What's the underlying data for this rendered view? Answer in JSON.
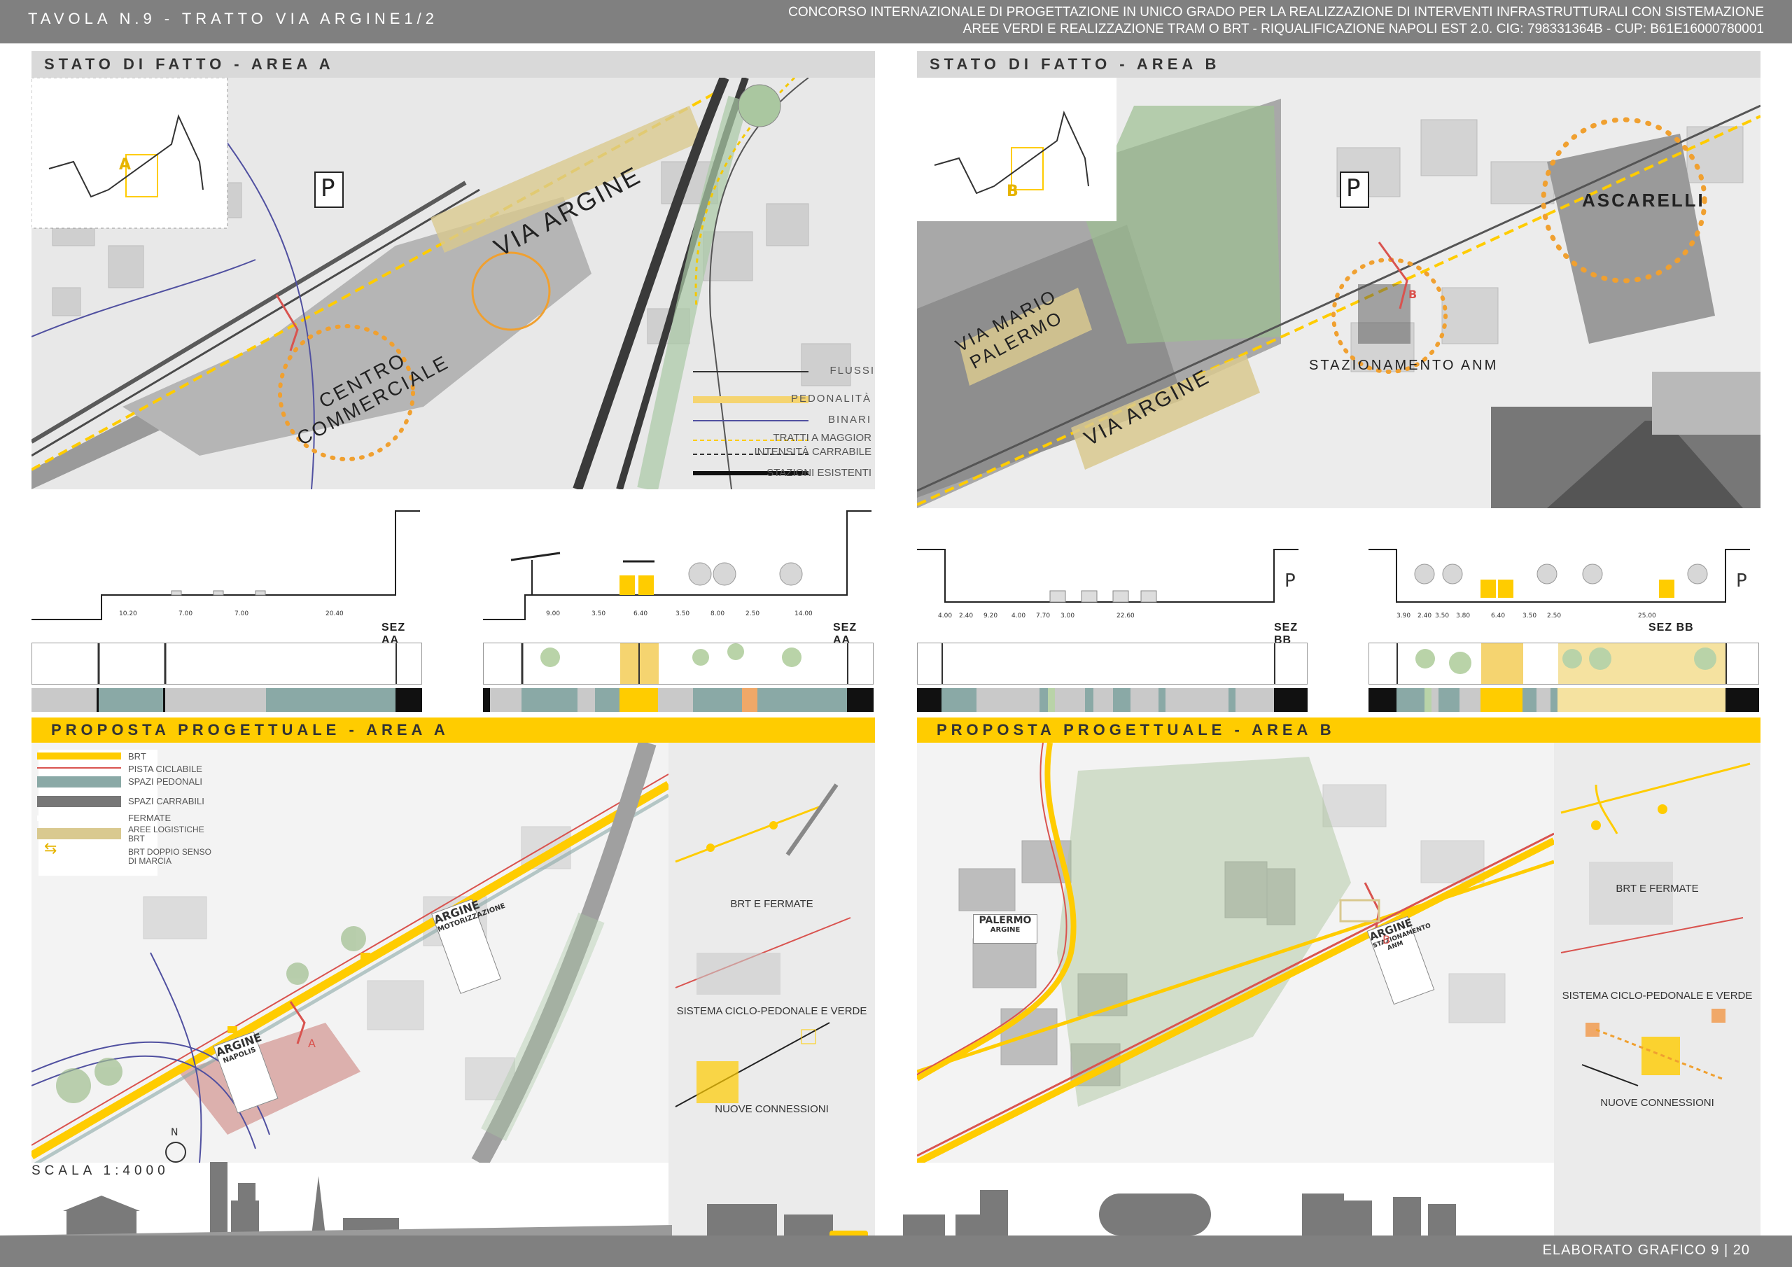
{
  "header": {
    "title_left": "TAVOLA N.9 - TRATTO VIA ARGINE1/2",
    "title_right_line1": "CONCORSO INTERNAZIONALE DI PROGETTAZIONE IN UNICO GRADO PER LA REALIZZAZIONE DI INTERVENTI INFRASTRUTTURALI CON SISTEMAZIONE",
    "title_right_line2": "AREE VERDI E REALIZZAZIONE TRAM O BRT - RIQUALIFICAZIONE NAPOLI EST 2.0. CIG: 798331364B - CUP: B61E16000780001"
  },
  "area_a_state": {
    "title": "STATO DI FATTO - AREA A",
    "key_map_letter": "A",
    "parking": "P",
    "street_label": "VIA ARGINE",
    "poi_label_1": "CENTRO",
    "poi_label_2": "COMMERCIALE",
    "legend": [
      {
        "label": "FLUSSI"
      },
      {
        "label": "PEDONALITÀ"
      },
      {
        "label": "BINARI"
      },
      {
        "label": "TRATTI A MAGGIOR"
      },
      {
        "label": "INTENSITÀ CARRABILE"
      },
      {
        "label": "STAZIONI ESISTENTI"
      }
    ]
  },
  "area_b_state": {
    "title": "STATO DI FATTO - AREA B",
    "key_map_letter": "B",
    "parking": "P",
    "street_label_1": "VIA MARIO",
    "street_label_2": "PALERMO",
    "street_label_main": "VIA ARGINE",
    "poi_1": "ASCARELLI",
    "poi_2": "STAZIONAMENTO ANM",
    "cut_marker": "B"
  },
  "sections": {
    "a_existing": {
      "label": "SEZ AA",
      "dims": [
        "10.20",
        "7.00",
        "7.00",
        "20.40"
      ]
    },
    "a_project": {
      "label": "SEZ AA",
      "dims": [
        "9.00",
        "3.50",
        "6.40",
        "3.50",
        "8.00",
        "2.50",
        "14.00"
      ]
    },
    "b_existing": {
      "label": "SEZ BB",
      "dims": [
        "4.00",
        "2.40",
        "9.20",
        "4.00",
        "7.70",
        "3.00",
        "22.60"
      ],
      "parking": "P"
    },
    "b_project": {
      "label": "SEZ BB",
      "dims": [
        "3.90",
        "2.40",
        "3.50",
        "3.80",
        "6.40",
        "3.50",
        "2.50",
        "25.00"
      ],
      "parking": "P"
    }
  },
  "proposal_a": {
    "title": "PROPOSTA PROGETTUALE - AREA A",
    "legend": [
      {
        "label": "BRT"
      },
      {
        "label": "PISTA CICLABILE"
      },
      {
        "label": "SPAZI PEDONALI"
      },
      {
        "label": "SPAZI CARRABILI"
      },
      {
        "label": "FERMATE"
      },
      {
        "label_1": "AREE LOGISTICHE",
        "label_2": "BRT"
      },
      {
        "label_1": "BRT DOPPIO SENSO",
        "label_2": "DI MARCIA"
      }
    ],
    "stop_1": "ARGINE",
    "stop_1_sub": "MOTORIZZAZIONE",
    "stop_2": "ARGINE",
    "stop_2_sub": "NAPOLIS",
    "cut_marker": "A",
    "side_captions": [
      "BRT E FERMATE",
      "SISTEMA CICLO-PEDONALE E VERDE",
      "NUOVE CONNESSIONI"
    ]
  },
  "proposal_b": {
    "title": "PROPOSTA PROGETTUALE - AREA B",
    "stop_1": "PALERMO",
    "stop_1_sub": "ARGINE",
    "stop_2": "ARGINE",
    "stop_2_sub": "STAZIONAMENTO ANM",
    "cut_marker": "B",
    "side_captions": [
      "BRT E FERMATE",
      "SISTEMA CICLO-PEDONALE E VERDE",
      "NUOVE CONNESSIONI"
    ]
  },
  "footer": {
    "north": "N",
    "scale": "SCALA 1:4000",
    "page": "ELABORATO GRAFICO 9 | 20"
  },
  "colors": {
    "yellow": "#ffcc00",
    "teal": "#8aa9a6",
    "grey": "#808080",
    "orange": "#f0a030",
    "red": "#d9534f"
  }
}
